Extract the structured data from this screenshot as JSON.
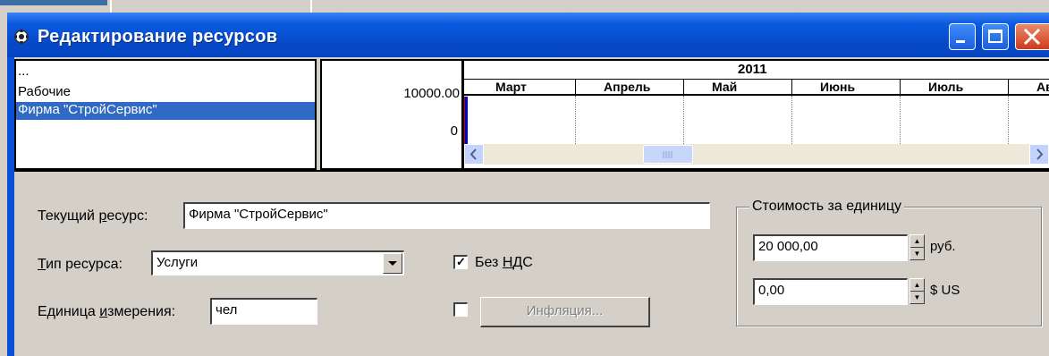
{
  "window": {
    "title": "Редактирование ресурсов"
  },
  "resource_list": {
    "items": [
      "...",
      "Рабочие",
      "Фирма \"СтройСервис\""
    ],
    "selected_index": 2
  },
  "scale": {
    "max_label": "10000.00",
    "min_label": "0"
  },
  "timeline": {
    "year": "2011",
    "months": [
      "Март",
      "Апрель",
      "Май",
      "Июнь",
      "Июль",
      "Авг"
    ]
  },
  "form": {
    "current_resource_label": "Текущий ресурс:",
    "current_resource_label_accel": "р",
    "current_resource_value": "Фирма \"СтройСервис\"",
    "resource_type_label": "Тип ресурса:",
    "resource_type_accel": "Т",
    "resource_type_value": "Услуги",
    "unit_label": "Единица измерения:",
    "unit_accel": "и",
    "unit_value": "чел",
    "no_vat_label": "Без НДС",
    "no_vat_checked": true,
    "inflation_checked": false,
    "inflation_button": "Инфляция..."
  },
  "cost_group": {
    "title": "Стоимость за единицу",
    "rub_value": "20 000,00",
    "rub_unit": "руб.",
    "usd_value": "0,00",
    "usd_unit": "$ US"
  },
  "colors": {
    "title_bar": "#0a5ae0",
    "selection": "#316ac5",
    "face": "#d4d0c8"
  }
}
